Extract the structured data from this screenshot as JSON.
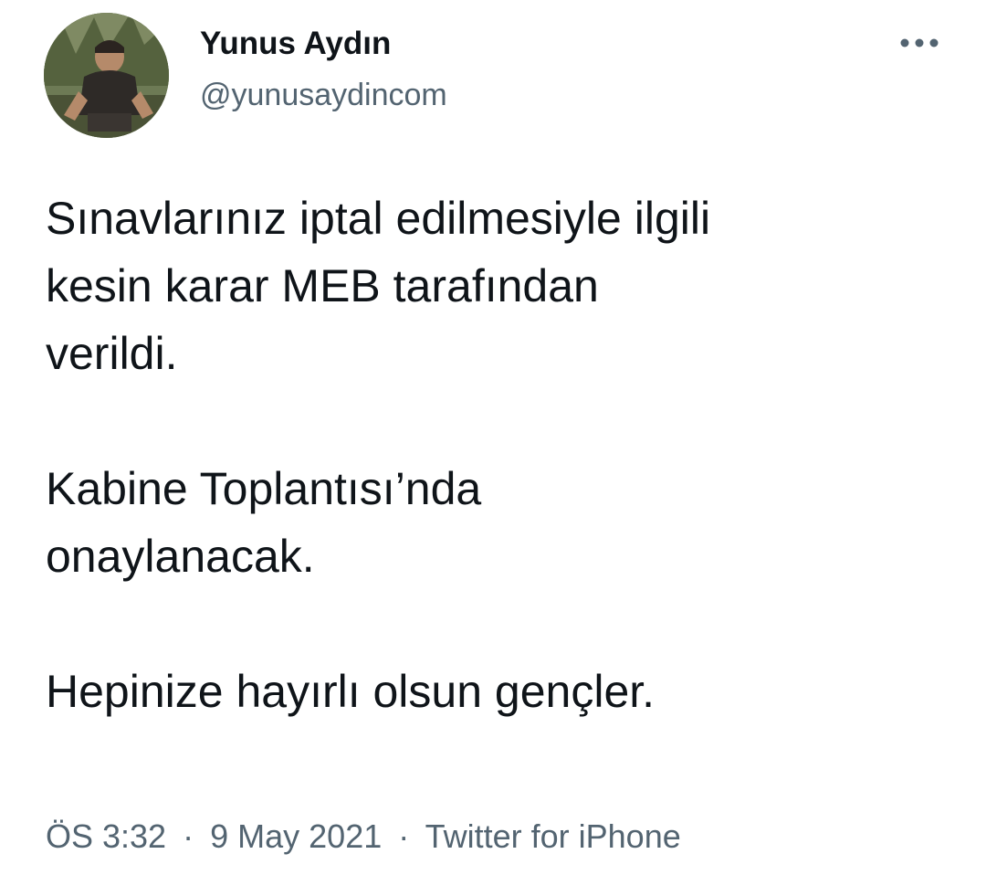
{
  "author": {
    "display_name": "Yunus Aydın",
    "handle": "@yunusaydincom",
    "avatar_icon": "profile-photo"
  },
  "tweet": {
    "paragraphs": [
      "Sınavlarınız iptal edilmesiyle ilgili\nkesin karar MEB tarafından\nverildi.",
      "Kabine Toplantısı’nda\nonaylanacak.",
      "Hepinize hayırlı olsun gençler."
    ]
  },
  "meta": {
    "time": "ÖS 3:32",
    "date": "9 May 2021",
    "separator": "·",
    "source": "Twitter for iPhone"
  },
  "icons": {
    "more": "more-horizontal-icon"
  },
  "colors": {
    "text_primary": "#0f1419",
    "text_secondary": "#536471"
  }
}
